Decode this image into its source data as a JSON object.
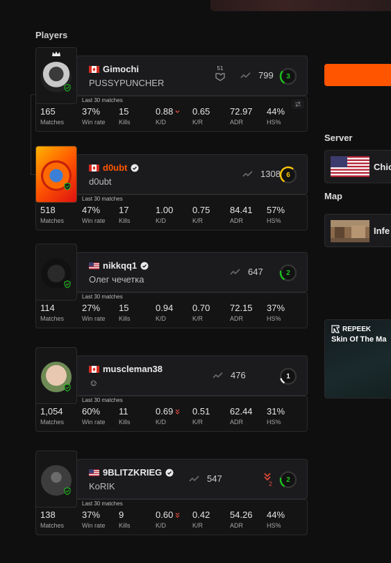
{
  "section_title": "Players",
  "last30_label": "Last 30 matches",
  "stat_labels": {
    "matches": "Matches",
    "winrate": "Win rate",
    "kills": "Kills",
    "kd": "K/D",
    "kr": "K/R",
    "adr": "ADR",
    "hs": "HS%"
  },
  "players": [
    {
      "nickname": "Gimochi",
      "country": "ca",
      "display_name": "PUSSYPUNCHER",
      "verified": false,
      "elo": "799",
      "level": "3",
      "level_color": "#1cc51c",
      "party_count": "51",
      "stats": {
        "matches": "165",
        "winrate": "37%",
        "kills": "15",
        "kd": "0.88",
        "kr": "0.65",
        "adr": "72.97",
        "hs": "44%"
      },
      "kd_trend": "down"
    },
    {
      "nickname": "d0ubt",
      "country": "ca",
      "display_name": "d0ubt",
      "verified": true,
      "nickname_color": "#ff5500",
      "elo": "1308",
      "level": "6",
      "level_color": "#ffc800",
      "stats": {
        "matches": "518",
        "winrate": "47%",
        "kills": "17",
        "kd": "1.00",
        "kr": "0.75",
        "adr": "84.41",
        "hs": "57%"
      }
    },
    {
      "nickname": "nikkqq1",
      "country": "us",
      "display_name": "Олег чечетка",
      "verified": true,
      "elo": "647",
      "level": "2",
      "level_color": "#1cc51c",
      "stats": {
        "matches": "114",
        "winrate": "27%",
        "kills": "15",
        "kd": "0.94",
        "kr": "0.70",
        "adr": "72.15",
        "hs": "37%"
      }
    },
    {
      "nickname": "muscleman38",
      "country": "ca",
      "display_name": "☺",
      "verified": false,
      "elo": "476",
      "level": "1",
      "level_color": "#eeeeee",
      "stats": {
        "matches": "1,054",
        "winrate": "60%",
        "kills": "11",
        "kd": "0.69",
        "kr": "0.51",
        "adr": "62.44",
        "hs": "31%"
      },
      "kd_trend": "down2"
    },
    {
      "nickname": "9BLITZKRIEG",
      "country": "us",
      "display_name": "KoRIK",
      "verified": true,
      "elo": "547",
      "level": "2",
      "level_color": "#1cc51c",
      "rank_drop": "2",
      "stats": {
        "matches": "138",
        "winrate": "37%",
        "kills": "9",
        "kd": "0.60",
        "kr": "0.42",
        "adr": "54.26",
        "hs": "44%"
      },
      "kd_trend": "down2"
    }
  ],
  "sidebar": {
    "server_label": "Server",
    "server_value": "Chic",
    "map_label": "Map",
    "map_value": "Infe",
    "promo_brand": "REPEEK",
    "promo_title": "Skin Of The Ma"
  },
  "colors": {
    "accent": "#ff5500",
    "level_green": "#1cc51c",
    "level_yellow": "#ffc800",
    "decline": "#e24a3b"
  }
}
